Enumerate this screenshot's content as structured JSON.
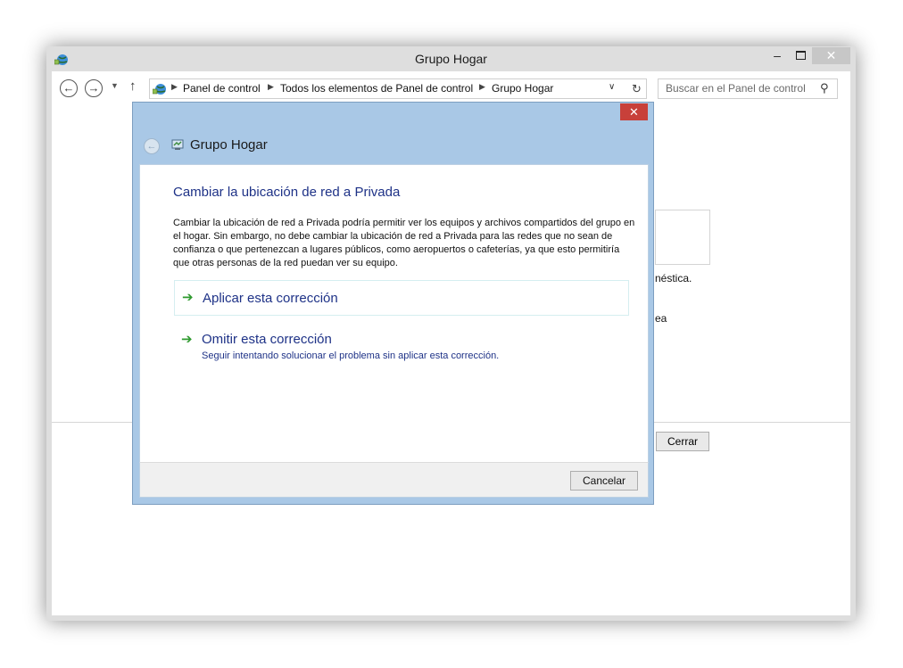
{
  "window": {
    "title": "Grupo Hogar",
    "minimize_glyph": "–",
    "close_glyph": "✕"
  },
  "nav": {
    "back_glyph": "←",
    "forward_glyph": "→",
    "recent_glyph": "▼",
    "up_glyph": "↑",
    "breadcrumbs": [
      "Panel de control",
      "Todos los elementos de Panel de control",
      "Grupo Hogar"
    ],
    "separator_glyph": "▶",
    "dropdown_glyph": "∨",
    "refresh_glyph": "↻",
    "search_placeholder": "Buscar en el Panel de control",
    "search_glyph": "⚲"
  },
  "background": {
    "text1": "néstica.",
    "text2": "ea",
    "close_button": "Cerrar"
  },
  "dialog": {
    "close_glyph": "✕",
    "back_glyph": "←",
    "title": "Grupo Hogar",
    "heading": "Cambiar la ubicación de red a Privada",
    "body": "Cambiar la ubicación de red a Privada podría permitir ver los equipos y archivos compartidos del grupo en el hogar. Sin embargo, no debe cambiar la ubicación de red a Privada para las redes que no sean de confianza o que pertenezcan a lugares públicos, como aeropuertos o cafeterías, ya que esto permitiría que otras personas de la red puedan ver su equipo.",
    "arrow_glyph": "➔",
    "option_apply": "Aplicar esta corrección",
    "option_skip": "Omitir esta corrección",
    "option_skip_desc": "Seguir intentando solucionar el problema sin aplicar esta corrección.",
    "cancel_button": "Cancelar"
  },
  "icons": {
    "window_icon": "network-globe-icon",
    "address_icon": "network-globe-icon",
    "dialog_title_icon": "homegroup-icon"
  },
  "colors": {
    "dialog_frame": "#a9c8e6",
    "close_red": "#c8403a",
    "link_blue": "#1e3287",
    "arrow_green": "#2f9a2f"
  }
}
